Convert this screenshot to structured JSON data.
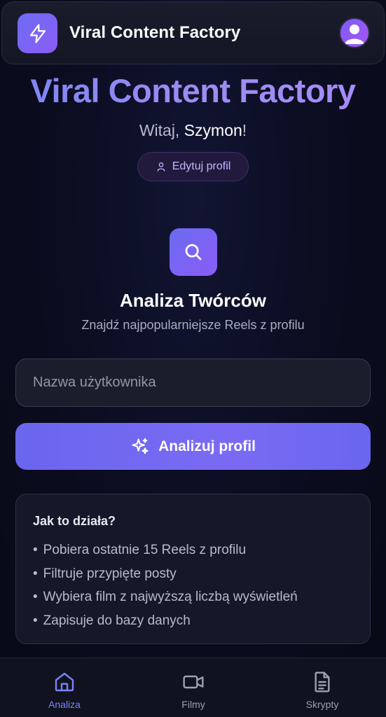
{
  "header": {
    "title": "Viral Content Factory",
    "logo_icon": "lightning-icon",
    "avatar_icon": "user-avatar-icon"
  },
  "hero": {
    "title": "Viral Content Factory",
    "greeting_prefix": "Witaj, ",
    "user_name": "Szymon",
    "greeting_suffix": "!",
    "edit_profile_label": "Edytuj profil"
  },
  "analysis": {
    "icon": "search-icon",
    "title": "Analiza Twórców",
    "subtitle": "Znajdź najpopularniejsze Reels z profilu",
    "input_placeholder": "Nazwa użytkownika",
    "input_value": "",
    "button_label": "Analizuj profil"
  },
  "info": {
    "title": "Jak to działa?",
    "items": [
      "Pobiera ostatnie 15 Reels z profilu",
      "Filtruje przypięte posty",
      "Wybiera film z najwyższą liczbą wyświetleń",
      "Zapisuje do bazy danych"
    ]
  },
  "nav": {
    "items": [
      {
        "label": "Analiza",
        "icon": "home-icon",
        "active": true
      },
      {
        "label": "Filmy",
        "icon": "video-camera-icon",
        "active": false
      },
      {
        "label": "Skrypty",
        "icon": "document-icon",
        "active": false
      }
    ]
  },
  "colors": {
    "accent": "#6d6cf2",
    "accent_secondary": "#8b5cf6",
    "active_nav": "#7d84f7",
    "background": "#0b0d21"
  }
}
